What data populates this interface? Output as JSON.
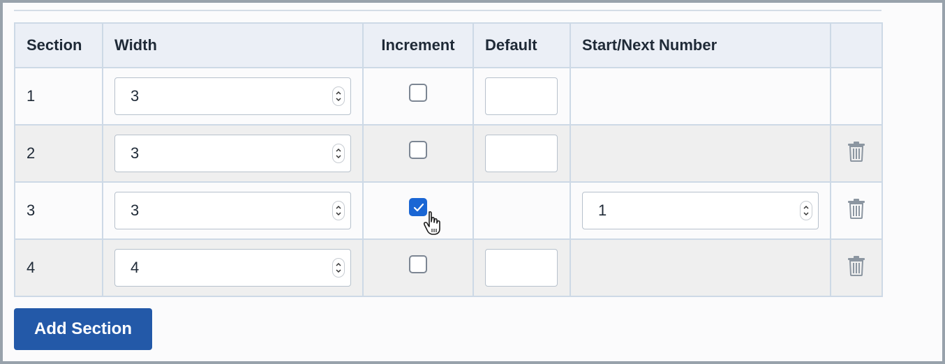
{
  "table": {
    "headers": {
      "section": "Section",
      "width": "Width",
      "increment": "Increment",
      "default": "Default",
      "start_next": "Start/Next Number",
      "actions": ""
    },
    "rows": [
      {
        "section": "1",
        "width": "3",
        "increment": false,
        "default": "",
        "start_next": null,
        "deletable": false
      },
      {
        "section": "2",
        "width": "3",
        "increment": false,
        "default": "",
        "start_next": null,
        "deletable": true
      },
      {
        "section": "3",
        "width": "3",
        "increment": true,
        "default": null,
        "start_next": "1",
        "deletable": true
      },
      {
        "section": "4",
        "width": "4",
        "increment": false,
        "default": "",
        "start_next": null,
        "deletable": true
      }
    ]
  },
  "add_button": {
    "label": "Add Section"
  },
  "colors": {
    "primary": "#2359a8",
    "checkbox_checked": "#1a66d4",
    "header_bg": "#ebeff6",
    "row_alt_bg": "#efefef",
    "border": "#cdd9e6"
  },
  "icons": {
    "delete": "trash-icon",
    "spinner": "spinner-arrows-icon",
    "check": "checkmark-icon",
    "cursor": "hand-pointer-icon"
  }
}
